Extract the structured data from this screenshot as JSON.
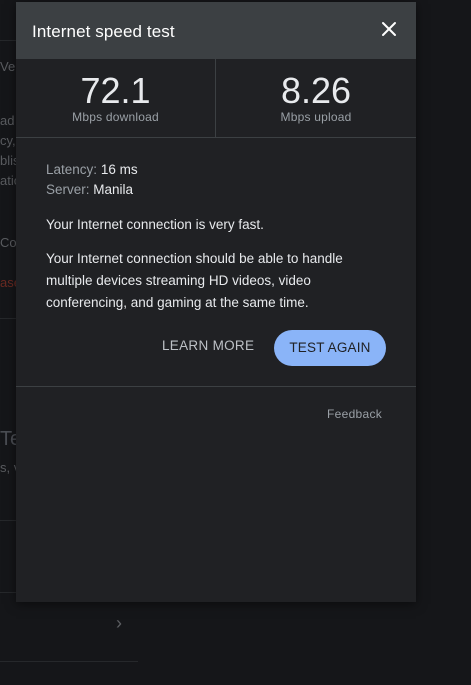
{
  "background": {
    "fragments": {
      "f1": "Vers",
      "f2": "ad",
      "f3": "cy,",
      "f4": "blis",
      "f5": "atio",
      "f6": "Co",
      "f7": "ase",
      "f8": "Te",
      "f9": "s, v",
      "chevron": "›"
    }
  },
  "dialog": {
    "title": "Internet speed test",
    "close_icon": "close-icon",
    "download": {
      "value": "72.1",
      "label": "Mbps download"
    },
    "upload": {
      "value": "8.26",
      "label": "Mbps upload"
    },
    "latency": {
      "key": "Latency:",
      "value": "16 ms"
    },
    "server": {
      "key": "Server:",
      "value": "Manila"
    },
    "summary": "Your Internet connection is very fast.",
    "description": "Your Internet connection should be able to handle multiple devices streaming HD videos, video conferencing, and gaming at the same time.",
    "learn_more": "LEARN MORE",
    "test_again": "TEST AGAIN",
    "feedback": "Feedback"
  },
  "colors": {
    "header": "#3c4043",
    "body": "#202124",
    "accent": "#8ab4f8",
    "backdrop": "#151619"
  }
}
